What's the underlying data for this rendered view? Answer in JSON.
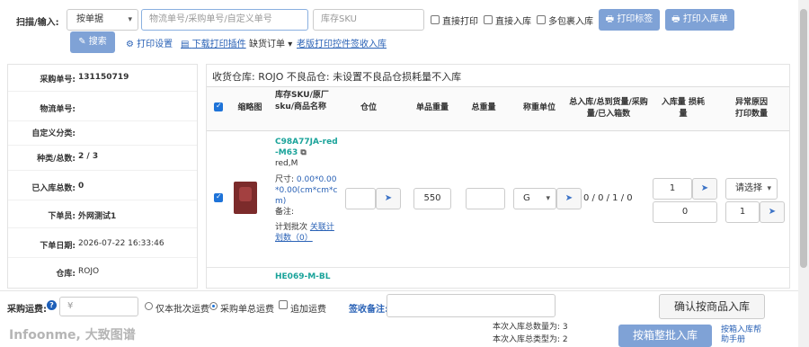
{
  "toolbar": {
    "scan_label": "扫描/输入:",
    "mode_select": "按单据",
    "search_placeholder": "物流单号/采购单号/自定义单号",
    "sku_placeholder": "库存SKU",
    "opt_direct_print": "直接打印",
    "opt_direct_stock": "直接入库",
    "opt_multi_pkg": "多包裹入库",
    "print_label_btn": "打印标签",
    "print_stockin_btn": "打印入库单",
    "search_btn": "搜索",
    "print_settings": "打印设置",
    "download_plugin": "下载打印插件",
    "missing_order": "缺货订单",
    "old_plugin_link": "老版打印控件签收入库"
  },
  "info": {
    "rows": [
      {
        "key": "采购单号:",
        "value": "131150719"
      },
      {
        "key": "物流单号:",
        "value": ""
      },
      {
        "key": "自定义分类:",
        "value": ""
      },
      {
        "key": "种类/总数:",
        "value": "2 / 3"
      },
      {
        "key": "已入库总数:",
        "value": "0"
      },
      {
        "key": "下单员:",
        "value": "外网测试1"
      },
      {
        "key": "下单日期:",
        "value": "2026-07-22 16:33:46"
      },
      {
        "key": "仓库:",
        "value": "ROJO"
      }
    ]
  },
  "main": {
    "warehouse_line": "收货仓库: ROJO    不良品仓: 未设置不良品仓损耗量不入库",
    "headers": {
      "thumb": "缩略图",
      "sku": "库存SKU/原厂sku/商品名称",
      "location": "仓位",
      "unit_weight": "单品重量",
      "total_weight": "总重量",
      "weight_unit": "称重单位",
      "totals": "总入库/总到货量/采购量/已入箱数",
      "stockin_qty": "入库量 损耗量",
      "exception": "异常原因 打印数量"
    },
    "item1": {
      "sku_link": "C98A77JA-red-M63",
      "variant": "red,M",
      "size_label": "尺寸:",
      "size_value": "0.00*0.00*0.00(cm*cm*cm)",
      "note_label": "备注:",
      "plan_text": "计划批次",
      "plan_link": "关联计划数（0）",
      "unit_weight": "550",
      "weight_unit": "G",
      "totals": "0 / 0 / 1 / 0",
      "stockin_qty": "1",
      "loss_qty": "0",
      "reason_select": "请选择",
      "print_qty": "1"
    },
    "item2": {
      "sku_link": "HE069-M-BL"
    }
  },
  "footer": {
    "freight_label": "采购运费:",
    "currency": "¥",
    "opt_batch_freight": "仅本批次运费",
    "opt_total_freight": "采购单总运费",
    "opt_add_freight": "追加运费",
    "remark_label": "签收备注:",
    "confirm_btn": "确认按商品入库",
    "batch_btn": "按箱整批入库",
    "guide_link": "按箱入库帮助手册",
    "total_qty": "本次入库总数量为: 3",
    "total_types": "本次入库总类型为: 2",
    "watermark": "Infoonme, 大致图谱"
  },
  "colors": {
    "accent": "#7fa2d6",
    "link": "#2a62b6",
    "sku_link": "#1aa39a"
  }
}
